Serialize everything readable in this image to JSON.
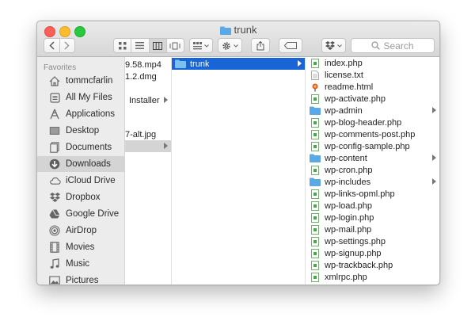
{
  "window": {
    "title": "trunk"
  },
  "toolbar": {
    "search_placeholder": "Search"
  },
  "sidebar": {
    "heading": "Favorites",
    "items": [
      {
        "label": "tommcfarlin",
        "icon": "home-icon"
      },
      {
        "label": "All My Files",
        "icon": "all-files-icon"
      },
      {
        "label": "Applications",
        "icon": "applications-icon"
      },
      {
        "label": "Desktop",
        "icon": "desktop-icon"
      },
      {
        "label": "Documents",
        "icon": "documents-icon"
      },
      {
        "label": "Downloads",
        "icon": "downloads-icon",
        "selected": true
      },
      {
        "label": "iCloud Drive",
        "icon": "cloud-icon"
      },
      {
        "label": "Dropbox",
        "icon": "dropbox-icon"
      },
      {
        "label": "Google Drive",
        "icon": "google-drive-icon"
      },
      {
        "label": "AirDrop",
        "icon": "airdrop-icon"
      },
      {
        "label": "Movies",
        "icon": "movies-icon"
      },
      {
        "label": "Music",
        "icon": "music-icon"
      },
      {
        "label": "Pictures",
        "icon": "pictures-icon"
      }
    ]
  },
  "column1": {
    "items": [
      {
        "label": "9.58.mp4",
        "folder": false
      },
      {
        "label": "1.2.dmg",
        "folder": false
      },
      {
        "label": "",
        "folder": false
      },
      {
        "label": "Installer",
        "folder": true
      },
      {
        "label": "",
        "folder": false
      },
      {
        "label": "",
        "folder": false
      },
      {
        "label": "7-alt.jpg",
        "folder": false
      },
      {
        "label": "",
        "folder": true,
        "selected": true
      }
    ]
  },
  "column2": {
    "items": [
      {
        "label": "trunk",
        "folder": true,
        "selected": true
      }
    ]
  },
  "column3": {
    "items": [
      {
        "label": "index.php",
        "type": "php"
      },
      {
        "label": "license.txt",
        "type": "txt"
      },
      {
        "label": "readme.html",
        "type": "html"
      },
      {
        "label": "wp-activate.php",
        "type": "php"
      },
      {
        "label": "wp-admin",
        "type": "folder"
      },
      {
        "label": "wp-blog-header.php",
        "type": "php"
      },
      {
        "label": "wp-comments-post.php",
        "type": "php"
      },
      {
        "label": "wp-config-sample.php",
        "type": "php"
      },
      {
        "label": "wp-content",
        "type": "folder"
      },
      {
        "label": "wp-cron.php",
        "type": "php"
      },
      {
        "label": "wp-includes",
        "type": "folder"
      },
      {
        "label": "wp-links-opml.php",
        "type": "php"
      },
      {
        "label": "wp-load.php",
        "type": "php"
      },
      {
        "label": "wp-login.php",
        "type": "php"
      },
      {
        "label": "wp-mail.php",
        "type": "php"
      },
      {
        "label": "wp-settings.php",
        "type": "php"
      },
      {
        "label": "wp-signup.php",
        "type": "php"
      },
      {
        "label": "wp-trackback.php",
        "type": "php"
      },
      {
        "label": "xmlrpc.php",
        "type": "php"
      }
    ]
  },
  "colors": {
    "selection": "#1965d6",
    "folder": "#5aa9e6",
    "php": "#4aa64a"
  }
}
